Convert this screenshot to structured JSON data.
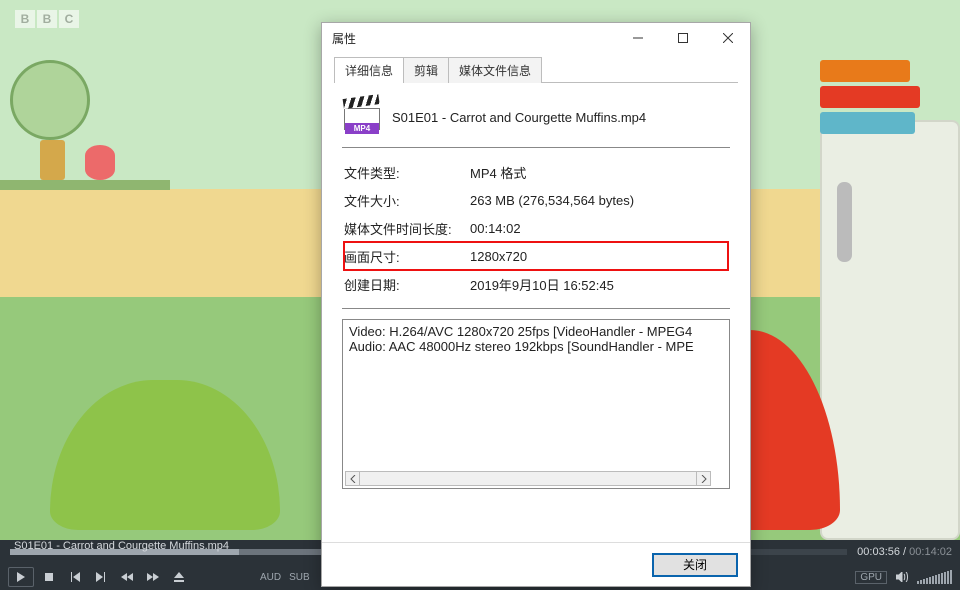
{
  "dialog": {
    "title": "属性",
    "tabs": {
      "details": "详细信息",
      "cut": "剪辑",
      "mediainfo": "媒体文件信息"
    },
    "icon_badge": "MP4",
    "filename": "S01E01 - Carrot and Courgette Muffins.mp4",
    "rows": {
      "filetype_label": "文件类型:",
      "filetype_value": "MP4 格式",
      "filesize_label": "文件大小:",
      "filesize_value": "263 MB (276,534,564 bytes)",
      "duration_label": "媒体文件时间长度:",
      "duration_value": "00:14:02",
      "dims_label": "画面尺寸:",
      "dims_value": "1280x720",
      "created_label": "创建日期:",
      "created_value": "2019年9月10日 16:52:45"
    },
    "codec_video": "Video: H.264/AVC 1280x720 25fps [VideoHandler - MPEG4",
    "codec_audio": "Audio: AAC 48000Hz stereo 192kbps [SoundHandler - MPE",
    "close": "关闭"
  },
  "player": {
    "filename": "S01E01 - Carrot and Courgette Muffins.mp4",
    "time_current": "00:03:56",
    "time_total": "00:14:02",
    "aud": "AUD",
    "sub": "SUB",
    "gpu": "GPU"
  }
}
